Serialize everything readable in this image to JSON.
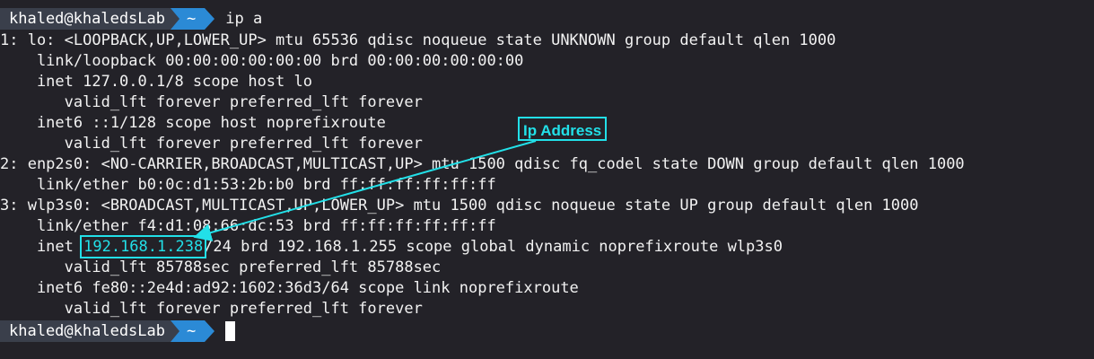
{
  "prompt": {
    "user_host": "khaled@khaledsLab",
    "dir": "~"
  },
  "command": "ip a",
  "output": [
    "1: lo: <LOOPBACK,UP,LOWER_UP> mtu 65536 qdisc noqueue state UNKNOWN group default qlen 1000",
    "    link/loopback 00:00:00:00:00:00 brd 00:00:00:00:00:00",
    "    inet 127.0.0.1/8 scope host lo",
    "       valid_lft forever preferred_lft forever",
    "    inet6 ::1/128 scope host noprefixroute",
    "       valid_lft forever preferred_lft forever",
    "2: enp2s0: <NO-CARRIER,BROADCAST,MULTICAST,UP> mtu 1500 qdisc fq_codel state DOWN group default qlen 1000",
    "    link/ether b0:0c:d1:53:2b:b0 brd ff:ff:ff:ff:ff:ff",
    "3: wlp3s0: <BROADCAST,MULTICAST,UP,LOWER_UP> mtu 1500 qdisc noqueue state UP group default qlen 1000",
    "    link/ether f4:d1:08:66:dc:53 brd ff:ff:ff:ff:ff:ff"
  ],
  "inet_line": {
    "prefix": "    inet ",
    "ip": "192.168.1.238",
    "suffix": "/24 brd 192.168.1.255 scope global dynamic noprefixroute wlp3s0"
  },
  "output_after": [
    "       valid_lft 85788sec preferred_lft 85788sec",
    "    inet6 fe80::2e4d:ad92:1602:36d3/64 scope link noprefixroute",
    "       valid_lft forever preferred_lft forever"
  ],
  "annotation": {
    "label": "Ip Address",
    "color": "#22e0e8"
  },
  "colors": {
    "background": "#232228",
    "prompt_user_bg": "#3a3f4b",
    "prompt_dir_bg": "#2b8ad6"
  }
}
